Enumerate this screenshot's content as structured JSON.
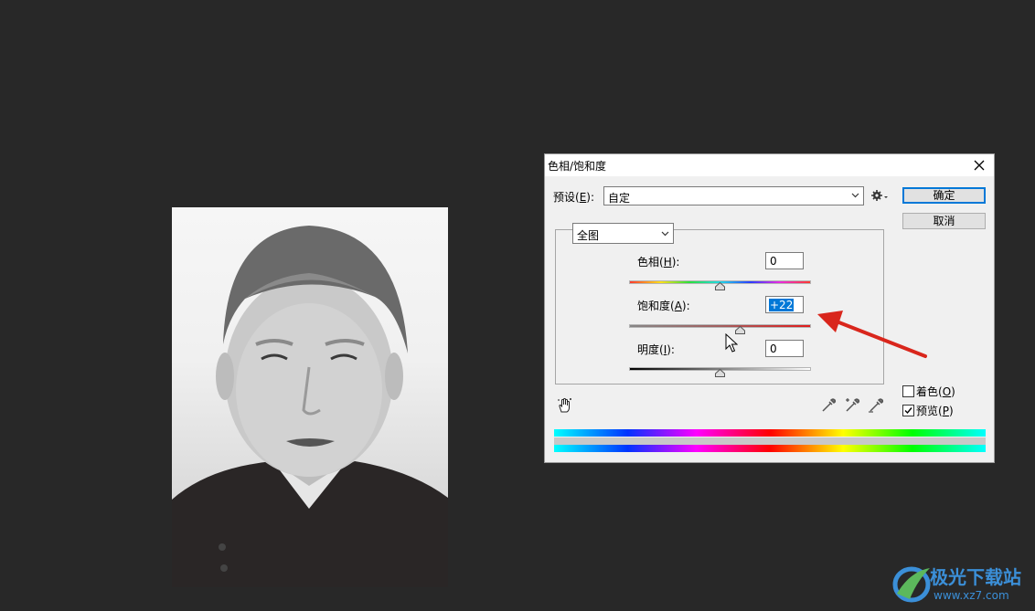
{
  "dialog": {
    "title": "色相/饱和度",
    "preset": {
      "label": "预设(",
      "key": "E",
      "suffix": "):",
      "value": "自定"
    },
    "ok_label": "确定",
    "cancel_label": "取消",
    "channel_value": "全图",
    "hue": {
      "label": "色相(",
      "key": "H",
      "suffix": "):",
      "value": "0",
      "level": 0,
      "range": [
        -180,
        180
      ]
    },
    "saturation": {
      "label": "饱和度(",
      "key": "A",
      "suffix": "):",
      "value": "+22",
      "level": 22,
      "range": [
        -100,
        100
      ]
    },
    "lightness": {
      "label": "明度(",
      "key": "I",
      "suffix": "):",
      "value": "0",
      "level": 0,
      "range": [
        -100,
        100
      ]
    },
    "colorize": {
      "label": "着色(",
      "key": "O",
      "suffix": ")",
      "checked": false
    },
    "preview": {
      "label": "预览(",
      "key": "P",
      "suffix": ")",
      "checked": true
    }
  },
  "icons": {
    "close": "close-icon",
    "gear": "gear-icon",
    "hand": "targeted-adjustment-hand-icon",
    "eyedroppers": [
      "eyedropper-icon",
      "eyedropper-plus-icon",
      "eyedropper-minus-icon"
    ]
  },
  "annotation_color": "#d9261c",
  "watermark": {
    "title": "极光下载站",
    "url": "www.xz7.com"
  }
}
